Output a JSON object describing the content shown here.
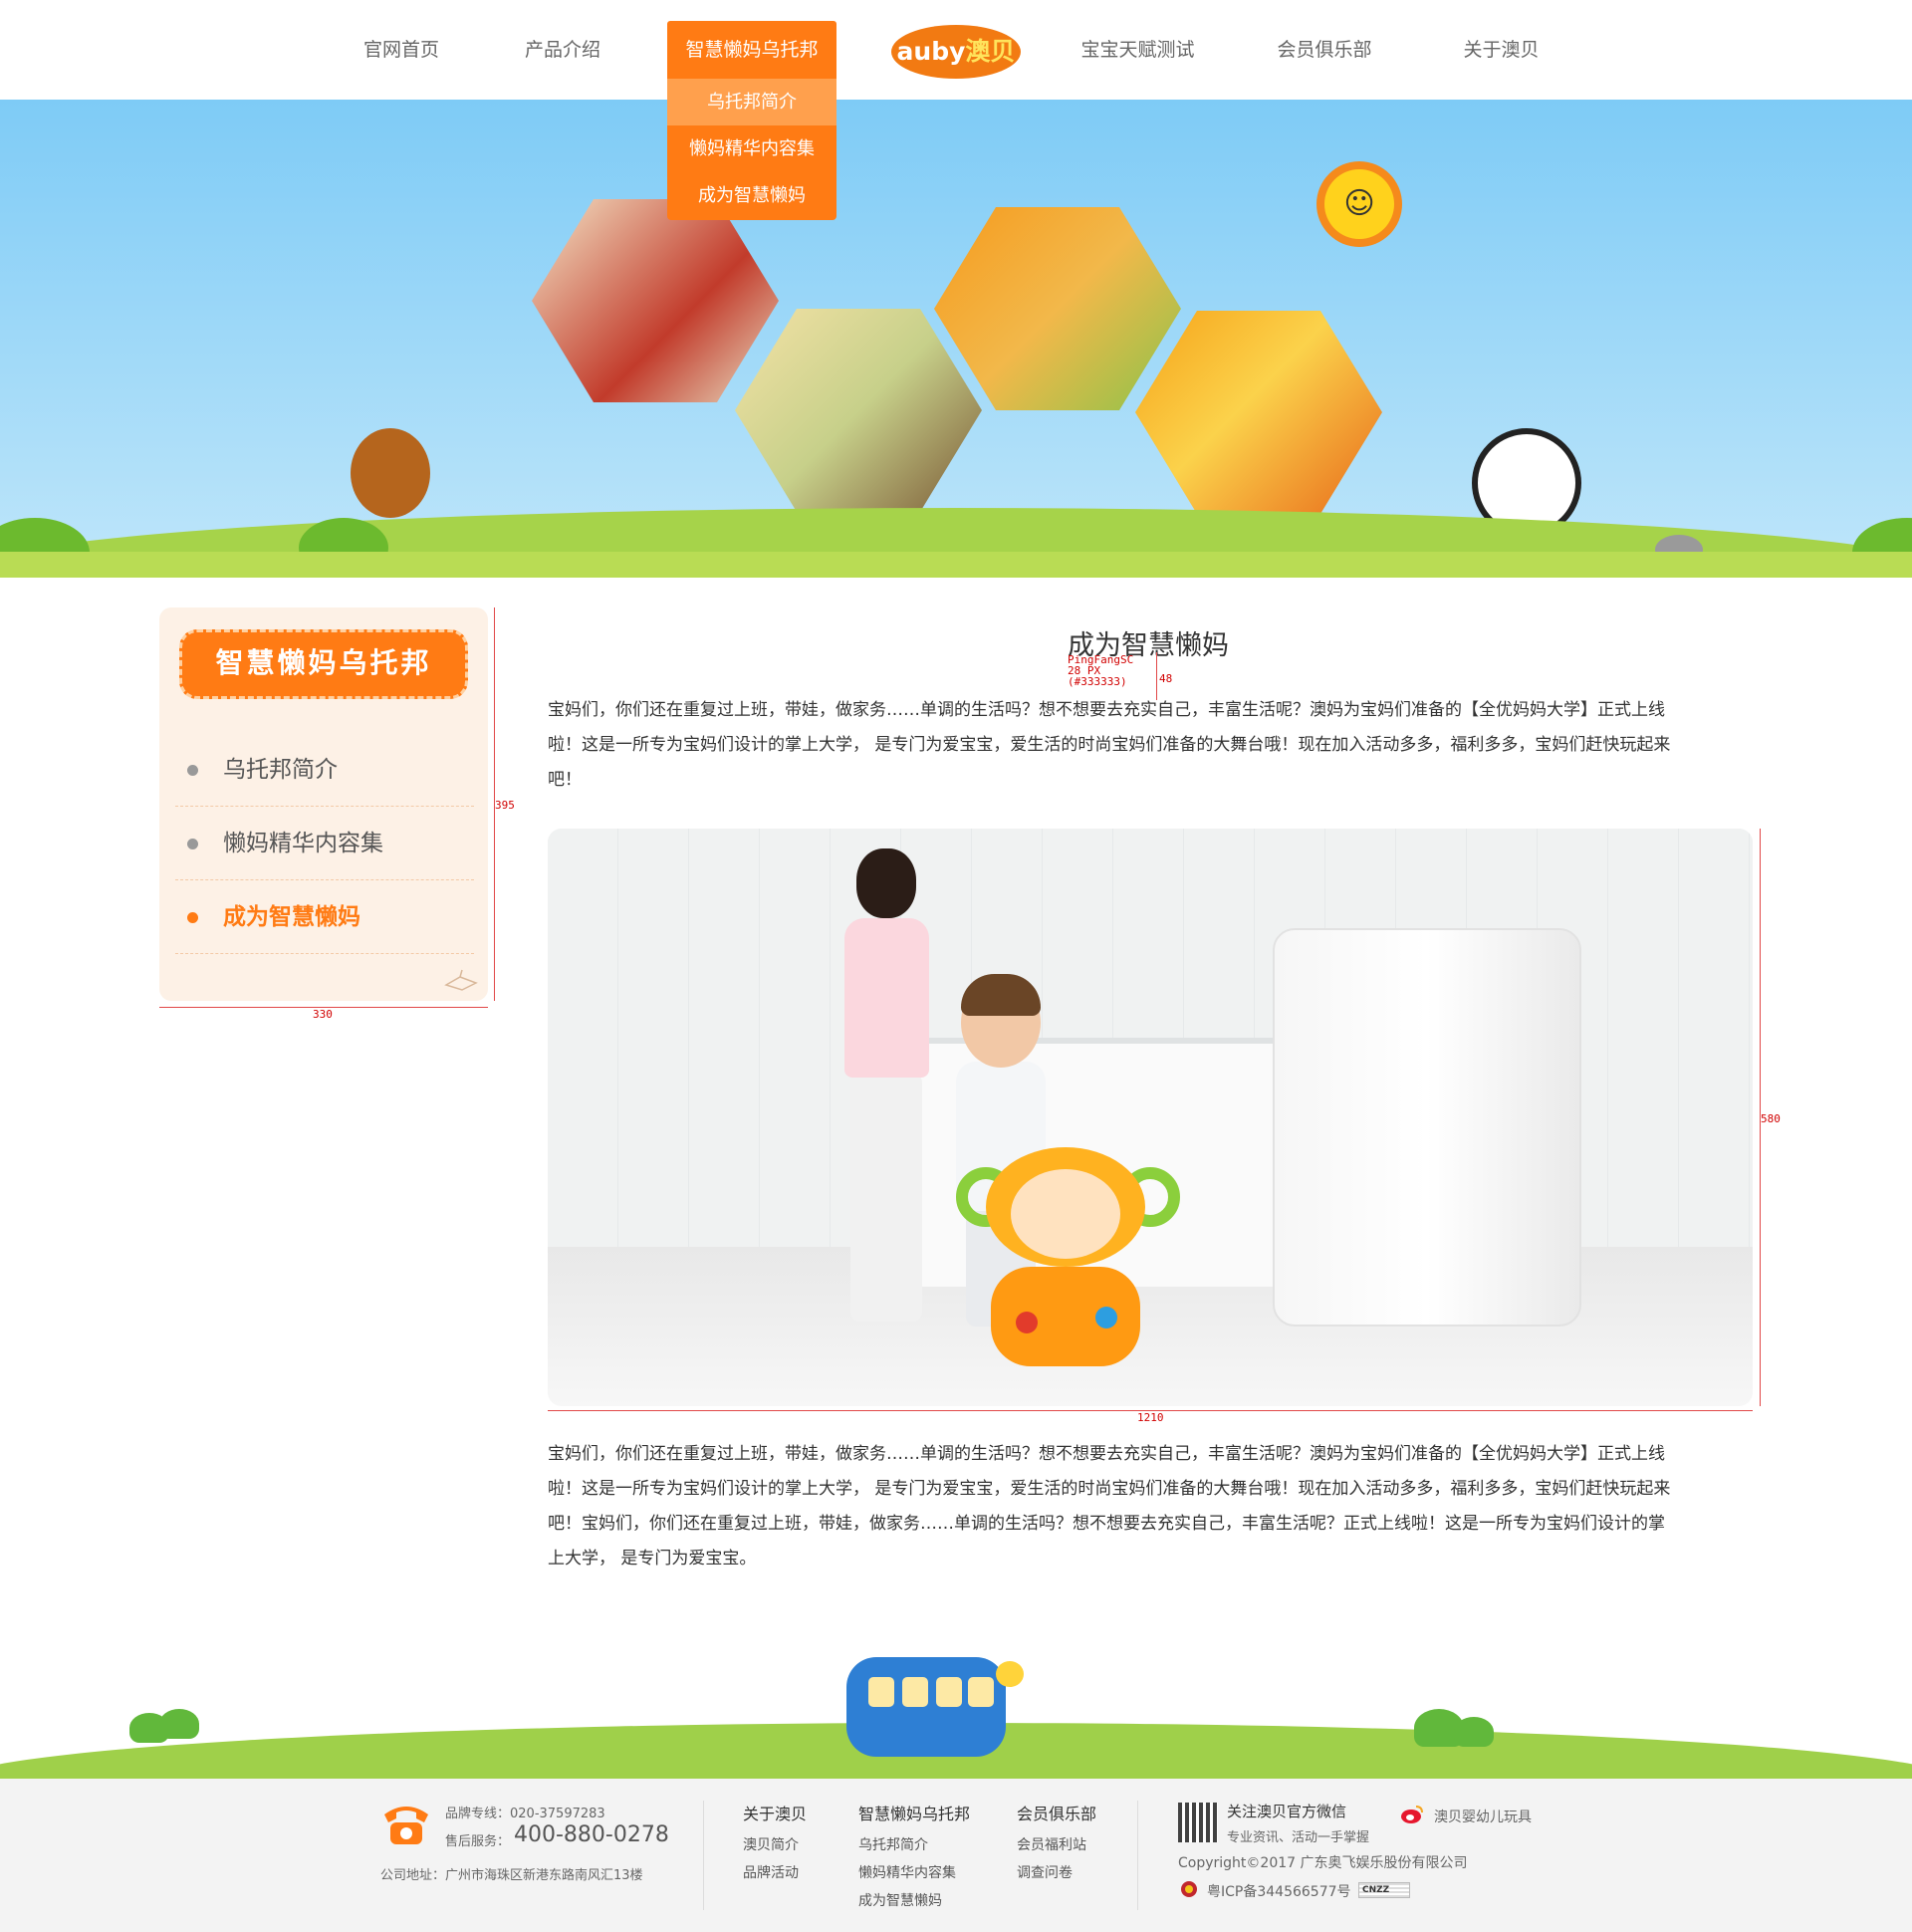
{
  "nav": {
    "items": [
      "官网首页",
      "产品介绍",
      "智慧懒妈乌托邦",
      "宝宝天赋测试",
      "会员俱乐部",
      "关于澳贝"
    ],
    "logo_text": "auby",
    "logo_cn": "澳贝",
    "dropdown": [
      "乌托邦简介",
      "懒妈精华内容集",
      "成为智慧懒妈"
    ]
  },
  "sidebar": {
    "title": "智慧懒妈乌托邦",
    "items": [
      "乌托邦简介",
      "懒妈精华内容集",
      "成为智慧懒妈"
    ],
    "active_index": 2
  },
  "annotations": {
    "sidebar_height": "395",
    "sidebar_width": "330",
    "title_font": "PingFangSC",
    "title_size": "28 PX",
    "title_color": "(#333333)",
    "title_lineheight": "48",
    "photo_width": "1210",
    "photo_height": "580"
  },
  "content": {
    "title": "成为智慧懒妈",
    "para1_l1": "宝妈们，你们还在重复过上班，带娃，做家务……单调的生活吗？想不想要去充实自己，丰富生活呢？澳妈为宝妈们准备的【全优妈妈大学】正式上线",
    "para1_l2": "啦！这是一所专为宝妈们设计的掌上大学， 是专门为爱宝宝，爱生活的时尚宝妈们准备的大舞台哦！现在加入活动多多，福利多多，宝妈们赶快玩起来",
    "para1_l3": "吧！",
    "para2_l1": "宝妈们，你们还在重复过上班，带娃，做家务……单调的生活吗？想不想要去充实自己，丰富生活呢？澳妈为宝妈们准备的【全优妈妈大学】正式上线",
    "para2_l2": "啦！这是一所专为宝妈们设计的掌上大学， 是专门为爱宝宝，爱生活的时尚宝妈们准备的大舞台哦！现在加入活动多多，福利多多，宝妈们赶快玩起来",
    "para2_l3": "吧！宝妈们，你们还在重复过上班，带娃，做家务……单调的生活吗？想不想要去充实自己，丰富生活呢？正式上线啦！这是一所专为宝妈们设计的掌",
    "para2_l4": "上大学， 是专门为爱宝宝。"
  },
  "footer": {
    "hotline_label": "品牌专线：020-37597283",
    "service_label": "售后服务：",
    "service_number": "400-880-0278",
    "address": "公司地址：广州市海珠区新港东路南风汇13楼",
    "col1": {
      "title": "关于澳贝",
      "links": [
        "澳贝简介",
        "品牌活动"
      ]
    },
    "col2": {
      "title": "智慧懒妈乌托邦",
      "links": [
        "乌托邦简介",
        "懒妈精华内容集",
        "成为智慧懒妈"
      ]
    },
    "col3": {
      "title": "会员俱乐部",
      "links": [
        "会员福利站",
        "调查问卷"
      ]
    },
    "wechat_title": "关注澳贝官方微信",
    "wechat_sub": "专业资讯、活动一手掌握",
    "weibo": "澳贝婴幼儿玩具",
    "copyright": "Copyright©2017 广东奥飞娱乐股份有限公司",
    "icp": "粤ICP备344566577号",
    "cnzz": "CNZZ"
  },
  "colors": {
    "accent": "#ff7b14",
    "sidebar_bg": "#fdf1e6",
    "footer_bg": "#f3f3f3"
  }
}
